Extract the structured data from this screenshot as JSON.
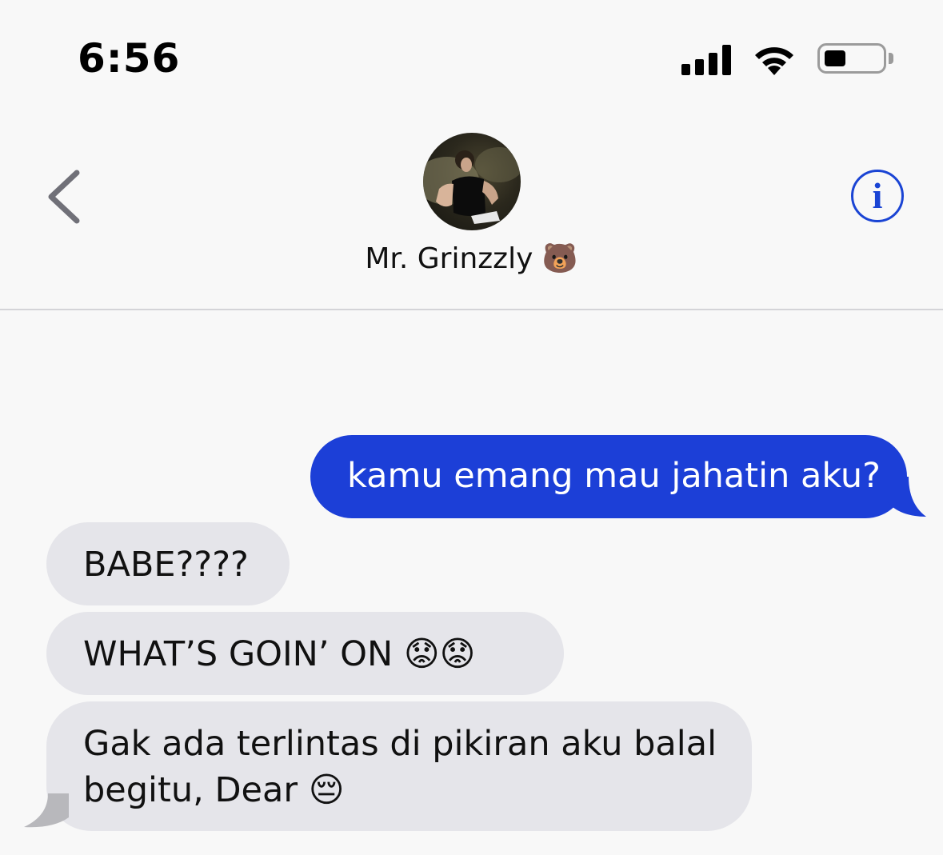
{
  "status_bar": {
    "time": "6:56"
  },
  "header": {
    "contact_name": "Mr. Grinzzly 🐻",
    "info_label": "i"
  },
  "messages": [
    {
      "direction": "sent",
      "text": "kamu emang mau jahatin aku?"
    },
    {
      "direction": "received",
      "text": "BABE????"
    },
    {
      "direction": "received",
      "text": "WHAT’S GOIN’ ON 😟😟"
    },
    {
      "direction": "received",
      "text": "Gak ada terlintas di pikiran aku balal begitu, Dear 😔"
    }
  ],
  "colors": {
    "sent_bubble": "#1c3fd7",
    "received_bubble": "#e5e5ea",
    "accent": "#1a44d4"
  },
  "icons": {
    "back": "chevron-left-icon",
    "info": "info-icon",
    "signal": "cellular-signal-icon",
    "wifi": "wifi-icon",
    "battery": "battery-icon"
  }
}
